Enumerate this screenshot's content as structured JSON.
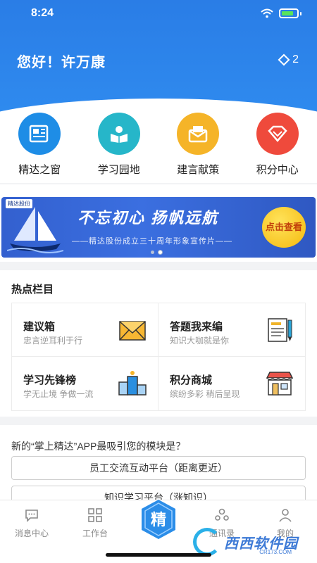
{
  "status_bar": {
    "time": "8:24"
  },
  "header": {
    "greeting": "您好！许万康",
    "points": "2"
  },
  "quick_links": [
    {
      "label": "精达之窗",
      "icon": "newspaper-icon",
      "color": "#1e8de6"
    },
    {
      "label": "学习园地",
      "icon": "reading-icon",
      "color": "#26b6c9"
    },
    {
      "label": "建言献策",
      "icon": "envelope-icon",
      "color": "#f5b428"
    },
    {
      "label": "积分中心",
      "icon": "diamond-icon",
      "color": "#ef4a3c"
    }
  ],
  "banner": {
    "logo": "精达股份",
    "title": "不忘初心 扬帆远航",
    "subtitle": "——精达股份成立三十周年形象宣传片——",
    "button": "点击查看"
  },
  "hot": {
    "title": "热点栏目",
    "items": [
      {
        "title": "建议箱",
        "sub": "忠言逆耳利于行",
        "icon": "mail-icon"
      },
      {
        "title": "答题我来编",
        "sub": "知识大咖就是你",
        "icon": "note-pen-icon"
      },
      {
        "title": "学习先锋榜",
        "sub": "学无止境 争做一流",
        "icon": "podium-icon"
      },
      {
        "title": "积分商城",
        "sub": "缤纷多彩 稍后呈现",
        "icon": "shop-icon"
      }
    ]
  },
  "survey": {
    "question": "新的“掌上精达”APP最吸引您的模块是？",
    "options": [
      "员工交流互动平台（距离更近）",
      "知识学习平台（涨知识）"
    ]
  },
  "tabbar": {
    "items": [
      {
        "label": "消息中心",
        "icon": "chat-icon"
      },
      {
        "label": "工作台",
        "icon": "grid-icon"
      },
      {
        "label": "精",
        "icon": "hexagon-logo-icon"
      },
      {
        "label": "通讯录",
        "icon": "contacts-icon"
      },
      {
        "label": "我的",
        "icon": "user-icon"
      }
    ]
  },
  "watermark": {
    "text": "西西软件园",
    "sub": "CR173.COM"
  }
}
